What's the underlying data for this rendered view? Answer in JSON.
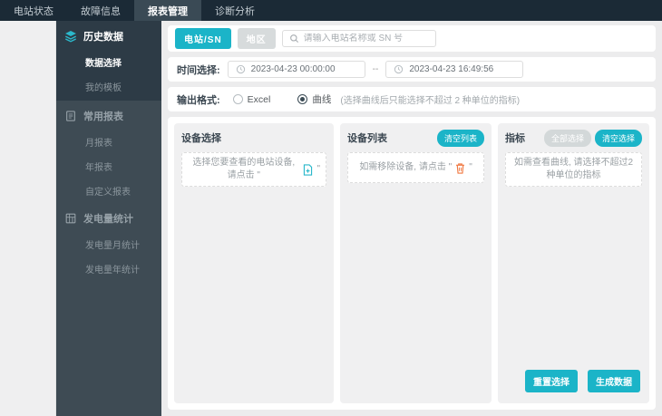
{
  "colors": {
    "accent": "#1bb4c8",
    "nav_bg": "#1b2a36",
    "sidebar_bg": "#3e4b54",
    "sidebar_group_bg": "#2d3b46",
    "trash_icon": "#f0773f"
  },
  "nav": {
    "items": [
      {
        "label": "电站状态"
      },
      {
        "label": "故障信息"
      },
      {
        "label": "报表管理"
      },
      {
        "label": "诊断分析"
      }
    ]
  },
  "sidebar": {
    "groups": [
      {
        "header": "历史数据",
        "icon": "layers-icon",
        "items": [
          {
            "label": "数据选择"
          },
          {
            "label": "我的模板"
          }
        ]
      },
      {
        "header": "常用报表",
        "icon": "report-icon",
        "items": [
          {
            "label": "月报表"
          },
          {
            "label": "年报表"
          },
          {
            "label": "自定义报表"
          }
        ]
      },
      {
        "header": "发电量统计",
        "icon": "grid-icon",
        "items": [
          {
            "label": "发电量月统计"
          },
          {
            "label": "发电量年统计"
          }
        ]
      }
    ]
  },
  "toolbar": {
    "tab_station": "电站/SN",
    "tab_region": "地区",
    "search_placeholder": "请输入电站名称或 SN 号"
  },
  "time_row": {
    "label": "时间选择:",
    "start": "2023-04-23 00:00:00",
    "separator": "--",
    "end": "2023-04-23 16:49:56"
  },
  "format_row": {
    "label": "输出格式:",
    "option_excel": "Excel",
    "option_curve": "曲线",
    "note": "(选择曲线后只能选择不超过 2 种单位的指标)"
  },
  "panels": {
    "device_select": {
      "title": "设备选择",
      "hint_before": "选择您要查看的电站设备, 请点击 \"",
      "hint_after": "\""
    },
    "device_list": {
      "title": "设备列表",
      "clear_label": "清空列表",
      "hint_before": "如需移除设备, 请点击 \"",
      "hint_after": "\""
    },
    "indicators": {
      "title": "指标",
      "select_all_label": "全部选择",
      "clear_label": "清空选择",
      "hint": "如需查看曲线, 请选择不超过2种单位的指标"
    }
  },
  "actions": {
    "reset_label": "重置选择",
    "generate_label": "生成数据"
  }
}
